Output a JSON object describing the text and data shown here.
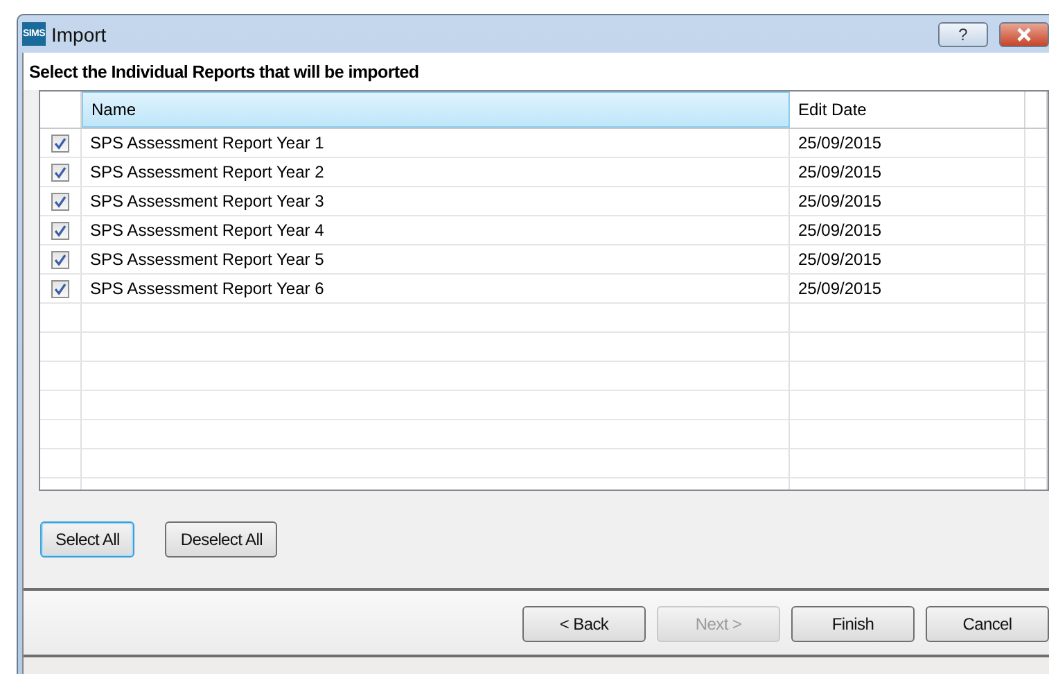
{
  "window": {
    "logo_text": "SIMS",
    "title": "Import",
    "help_button": "?"
  },
  "heading": "Select the Individual Reports that will be imported",
  "table": {
    "columns": [
      "Name",
      "Edit Date"
    ],
    "rows": [
      {
        "checked": true,
        "name": "SPS Assessment Report Year 1",
        "edit_date": "25/09/2015"
      },
      {
        "checked": true,
        "name": "SPS Assessment Report Year 2",
        "edit_date": "25/09/2015"
      },
      {
        "checked": true,
        "name": "SPS Assessment Report Year 3",
        "edit_date": "25/09/2015"
      },
      {
        "checked": true,
        "name": "SPS Assessment Report Year 4",
        "edit_date": "25/09/2015"
      },
      {
        "checked": true,
        "name": "SPS Assessment Report Year 5",
        "edit_date": "25/09/2015"
      },
      {
        "checked": true,
        "name": "SPS Assessment Report Year 6",
        "edit_date": "25/09/2015"
      }
    ]
  },
  "selection_buttons": [
    {
      "label": "Select All",
      "focused": true
    },
    {
      "label": "Deselect All",
      "focused": false
    }
  ],
  "wizard_buttons": [
    {
      "label": "< Back",
      "disabled": false
    },
    {
      "label": "Next >",
      "disabled": true
    },
    {
      "label": "Finish",
      "disabled": false
    },
    {
      "label": "Cancel",
      "disabled": false
    }
  ]
}
